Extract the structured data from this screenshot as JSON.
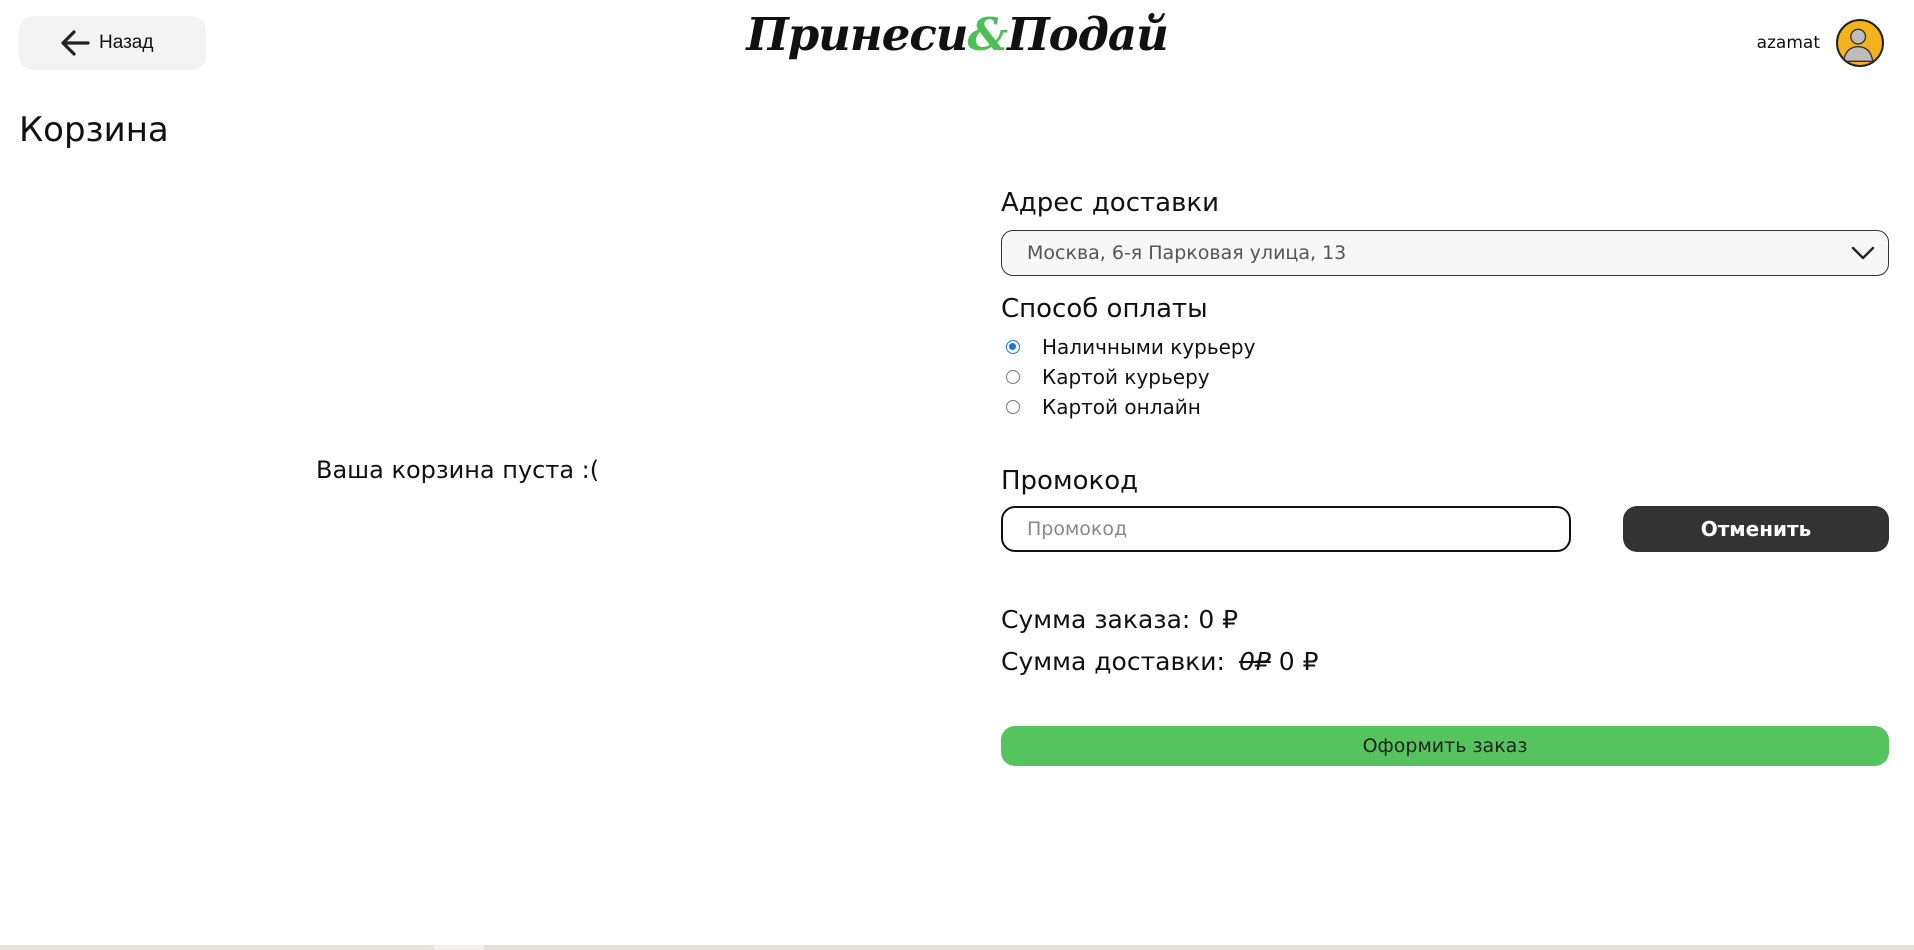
{
  "header": {
    "back_label": "Назад",
    "logo_part1": "Принеси",
    "logo_amp": "&",
    "logo_part2": "Подай",
    "username": "azamat"
  },
  "page": {
    "title": "Корзина",
    "empty_cart_message": "Ваша корзина пуста :("
  },
  "delivery": {
    "title": "Адрес доставки",
    "selected_address": "Москва, 6-я Парковая улица, 13"
  },
  "payment": {
    "title": "Способ оплаты",
    "options": [
      {
        "label": "Наличными курьеру",
        "selected": true
      },
      {
        "label": "Картой курьеру",
        "selected": false
      },
      {
        "label": "Картой онлайн",
        "selected": false
      }
    ]
  },
  "promo": {
    "title": "Промокод",
    "placeholder": "Промокод",
    "value": "",
    "cancel_label": "Отменить"
  },
  "totals": {
    "order_label": "Сумма заказа:",
    "order_value": "0 ₽",
    "delivery_label": "Сумма доставки:",
    "delivery_old_value": "0₽",
    "delivery_value": "0 ₽"
  },
  "checkout": {
    "label": "Оформить заказ"
  },
  "colors": {
    "accent_green": "#55c45e",
    "logo_green": "#4cbf57",
    "dark_button": "#333333",
    "avatar_bg": "#f6b21a",
    "radio_selected": "#1a73e8"
  },
  "icons": {
    "back": "arrow-left-icon",
    "dropdown": "chevron-down-icon",
    "avatar": "user-avatar-icon"
  }
}
